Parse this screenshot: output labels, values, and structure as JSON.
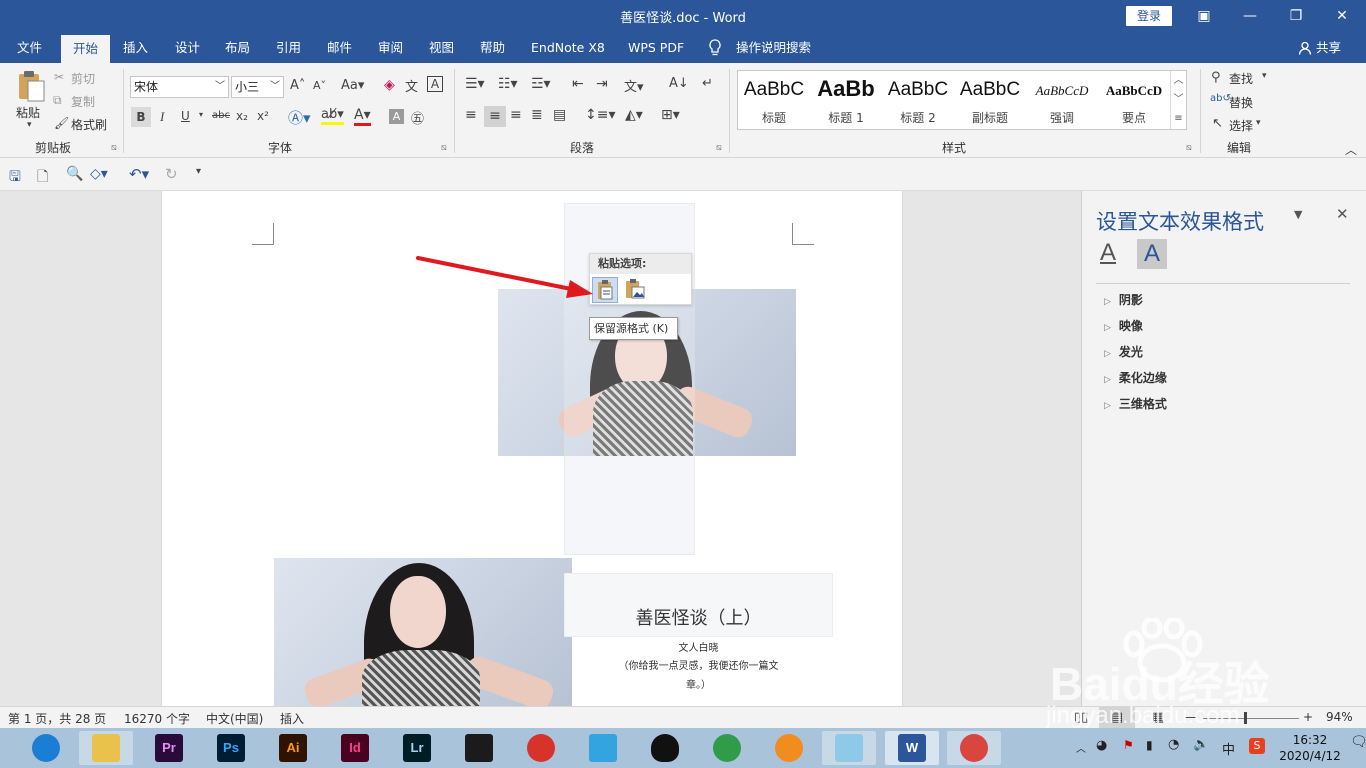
{
  "window": {
    "title": "善医怪谈.doc  -  Word",
    "login_label": "登录",
    "min_glyph": "—",
    "restore_glyph": "❐",
    "close_glyph": "✕",
    "ribbon_display_glyph": "▣"
  },
  "tabs": [
    "文件",
    "开始",
    "插入",
    "设计",
    "布局",
    "引用",
    "邮件",
    "审阅",
    "视图",
    "帮助",
    "EndNote X8",
    "WPS PDF"
  ],
  "active_tab": "开始",
  "tell_me": "操作说明搜索",
  "share_label": "共享",
  "ribbon": {
    "clipboard": {
      "group": "剪贴板",
      "paste": "粘贴",
      "cut": "剪切",
      "copy": "复制",
      "format_painter": "格式刷"
    },
    "font": {
      "group": "字体",
      "font_name": "宋体",
      "font_size": "小三",
      "bold": "B",
      "italic": "I",
      "underline": "U",
      "strike": "abc",
      "sub": "x₂",
      "sup": "x²"
    },
    "paragraph": {
      "group": "段落"
    },
    "styles": {
      "group": "样式",
      "items": [
        {
          "sample": "AaBbC",
          "name": "标题"
        },
        {
          "sample": "AaBb",
          "name": "标题 1"
        },
        {
          "sample": "AaBbC",
          "name": "标题 2"
        },
        {
          "sample": "AaBbC",
          "name": "副标题"
        },
        {
          "sample": "AaBbCcD",
          "name": "强调"
        },
        {
          "sample": "AaBbCcD",
          "name": "要点"
        }
      ]
    },
    "editing": {
      "group": "编辑",
      "find": "查找",
      "replace": "替换",
      "select": "选择"
    }
  },
  "document": {
    "paste_options_label": "粘贴选项:",
    "tooltip": "保留源格式 (K)",
    "heading": "善医怪谈（上）",
    "author": "文人白晓",
    "subline1": "（你给我一点灵感，我便还你一篇文",
    "subline2": "章。）"
  },
  "pane": {
    "title": "设置文本效果格式",
    "items": [
      "阴影",
      "映像",
      "发光",
      "柔化边缘",
      "三维格式"
    ]
  },
  "status": {
    "page": "第 1 页，共 28 页",
    "words": "16270 个字",
    "language": "中文(中国)",
    "mode": "插入",
    "zoom": "94%"
  },
  "taskbar": {
    "apps": [
      {
        "name": "browser",
        "label": "",
        "color": "#1a7fd4"
      },
      {
        "name": "explorer",
        "label": "",
        "color": "#e8c24a"
      },
      {
        "name": "premiere",
        "label": "Pr",
        "color": "#2a0a3a"
      },
      {
        "name": "photoshop",
        "label": "Ps",
        "color": "#001d34"
      },
      {
        "name": "illustrator",
        "label": "Ai",
        "color": "#2d1300"
      },
      {
        "name": "indesign",
        "label": "Id",
        "color": "#49021f"
      },
      {
        "name": "lightroom",
        "label": "Lr",
        "color": "#001c25"
      },
      {
        "name": "video",
        "label": "",
        "color": "#1b1b1b"
      },
      {
        "name": "app-umbrella",
        "label": "",
        "color": "#d8332b"
      },
      {
        "name": "app-cat",
        "label": "",
        "color": "#34a4e0"
      },
      {
        "name": "qq",
        "label": "",
        "color": "#111111"
      },
      {
        "name": "chrome",
        "label": "",
        "color": "#2f9c49"
      },
      {
        "name": "app-orange",
        "label": "",
        "color": "#f18c1f"
      },
      {
        "name": "app-note",
        "label": "",
        "color": "#8fc9e8"
      },
      {
        "name": "word",
        "label": "W",
        "color": "#2b579a"
      },
      {
        "name": "app-avatar",
        "label": "",
        "color": "#d9463e"
      }
    ],
    "ime": "中",
    "time": "16:32",
    "date": "2020/4/12"
  },
  "watermark": {
    "text": "Baidu经验",
    "url": "jingyan.baidu.com"
  },
  "colors": {
    "brand": "#2b579a",
    "arrow": "#e0191e"
  }
}
